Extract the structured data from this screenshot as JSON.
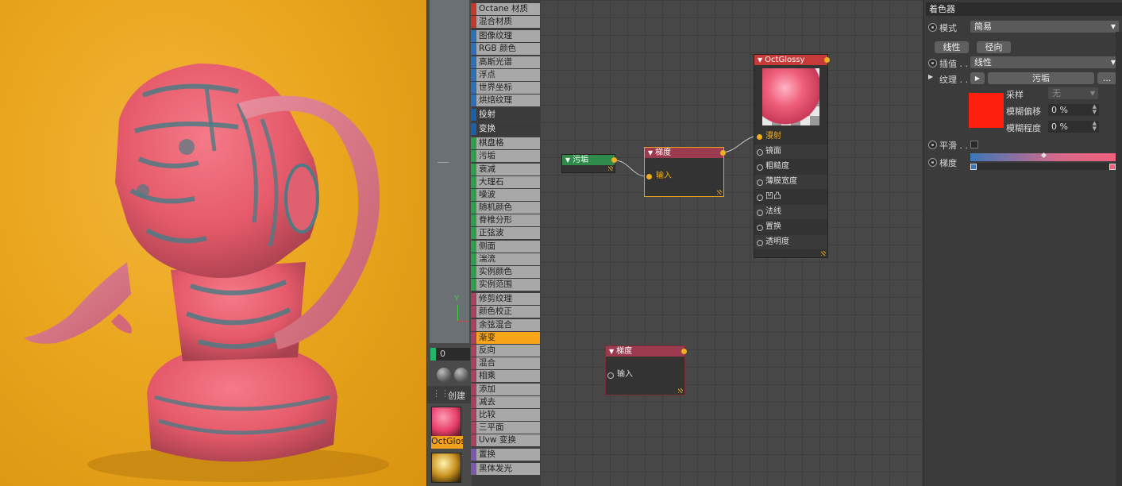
{
  "menu": {
    "items": [
      {
        "label": "Octane 材质",
        "color": "#c0392b",
        "style": "normal"
      },
      {
        "label": "混合材质",
        "color": "#c0392b",
        "style": "normal"
      },
      {
        "label": "图像纹理",
        "color": "#2f6fb5",
        "style": "normal",
        "gap": true
      },
      {
        "label": "RGB 颜色",
        "color": "#2f6fb5",
        "style": "normal"
      },
      {
        "label": "高斯光谱",
        "color": "#2f6fb5",
        "style": "normal"
      },
      {
        "label": "浮点",
        "color": "#2f6fb5",
        "style": "normal"
      },
      {
        "label": "世界坐标",
        "color": "#2f6fb5",
        "style": "normal"
      },
      {
        "label": "烘焙纹理",
        "color": "#2f6fb5",
        "style": "normal"
      },
      {
        "label": "投射",
        "color": "#1d5fa8",
        "style": "dark",
        "gap": true
      },
      {
        "label": "变换",
        "color": "#1d5fa8",
        "style": "dark",
        "gap": true
      },
      {
        "label": "棋盘格",
        "color": "#2f9e4d",
        "style": "normal",
        "gap": true
      },
      {
        "label": "污垢",
        "color": "#2f9e4d",
        "style": "normal"
      },
      {
        "label": "衰减",
        "color": "#2f9e4d",
        "style": "normal"
      },
      {
        "label": "大理石",
        "color": "#2f9e4d",
        "style": "normal"
      },
      {
        "label": "噪波",
        "color": "#2f9e4d",
        "style": "normal"
      },
      {
        "label": "随机颜色",
        "color": "#2f9e4d",
        "style": "normal"
      },
      {
        "label": "脊椎分形",
        "color": "#2f9e4d",
        "style": "normal"
      },
      {
        "label": "正弦波",
        "color": "#2f9e4d",
        "style": "normal"
      },
      {
        "label": "侧面",
        "color": "#2f9e4d",
        "style": "normal"
      },
      {
        "label": "湍流",
        "color": "#2f9e4d",
        "style": "normal"
      },
      {
        "label": "实例颜色",
        "color": "#2f9e4d",
        "style": "normal"
      },
      {
        "label": "实例范围",
        "color": "#2f9e4d",
        "style": "normal"
      },
      {
        "label": "修剪纹理",
        "color": "#a8425a",
        "style": "normal",
        "gap": true
      },
      {
        "label": "颜色校正",
        "color": "#a8425a",
        "style": "normal"
      },
      {
        "label": "余弦混合",
        "color": "#a8425a",
        "style": "normal"
      },
      {
        "label": "渐变",
        "color": "#a8425a",
        "style": "selected"
      },
      {
        "label": "反向",
        "color": "#a8425a",
        "style": "normal"
      },
      {
        "label": "混合",
        "color": "#a8425a",
        "style": "normal"
      },
      {
        "label": "相乘",
        "color": "#a8425a",
        "style": "normal"
      },
      {
        "label": "添加",
        "color": "#a8425a",
        "style": "normal"
      },
      {
        "label": "减去",
        "color": "#a8425a",
        "style": "normal"
      },
      {
        "label": "比较",
        "color": "#a8425a",
        "style": "normal"
      },
      {
        "label": "三平面",
        "color": "#a8425a",
        "style": "normal"
      },
      {
        "label": "Uvw 变换",
        "color": "#a8425a",
        "style": "normal"
      },
      {
        "label": "置换",
        "color": "#7a5aa8",
        "style": "normal",
        "gap": true
      },
      {
        "label": "黑体发光",
        "color": "#7a5aa8",
        "style": "normal",
        "gap": true
      }
    ]
  },
  "left_panel": {
    "axis_label": "Y",
    "frame_value": "0",
    "create_label": "创建",
    "material1_label": "OctGlossy"
  },
  "nodes": {
    "dirt": {
      "title": "污垢",
      "color": "#2e8b4a"
    },
    "gradient1": {
      "title": "梯度",
      "color": "#9c3a4f",
      "ports": [
        "输入"
      ]
    },
    "gradient2": {
      "title": "梯度",
      "color": "#9c3a4f",
      "ports": [
        "输入"
      ]
    },
    "glossy": {
      "title": "OctGlossy",
      "color": "#c83a3a",
      "ports": [
        "漫射",
        "镜面",
        "粗糙度",
        "薄膜宽度",
        "凹凸",
        "法线",
        "置换",
        "透明度"
      ]
    }
  },
  "attributes": {
    "panel_title": "着色器",
    "mode_label": "模式",
    "mode_value": "简易",
    "btn_linear": "线性",
    "btn_radial": "径向",
    "interp_label": "插值 . .",
    "interp_value": "线性",
    "texture_label": "纹理 . .",
    "texture_value": "污垢",
    "texture_more": "...",
    "sample_label": "采样",
    "sample_value": "无",
    "blur_offset_label": "模糊偏移",
    "blur_offset_value": "0 %",
    "blur_amount_label": "模糊程度",
    "blur_amount_value": "0 %",
    "smooth_label": "平滑 . .",
    "gradient_label": "梯度",
    "swatch_color": "#ff1f0f",
    "gradient_colors": [
      "#3c78b8",
      "#f0607c"
    ]
  }
}
